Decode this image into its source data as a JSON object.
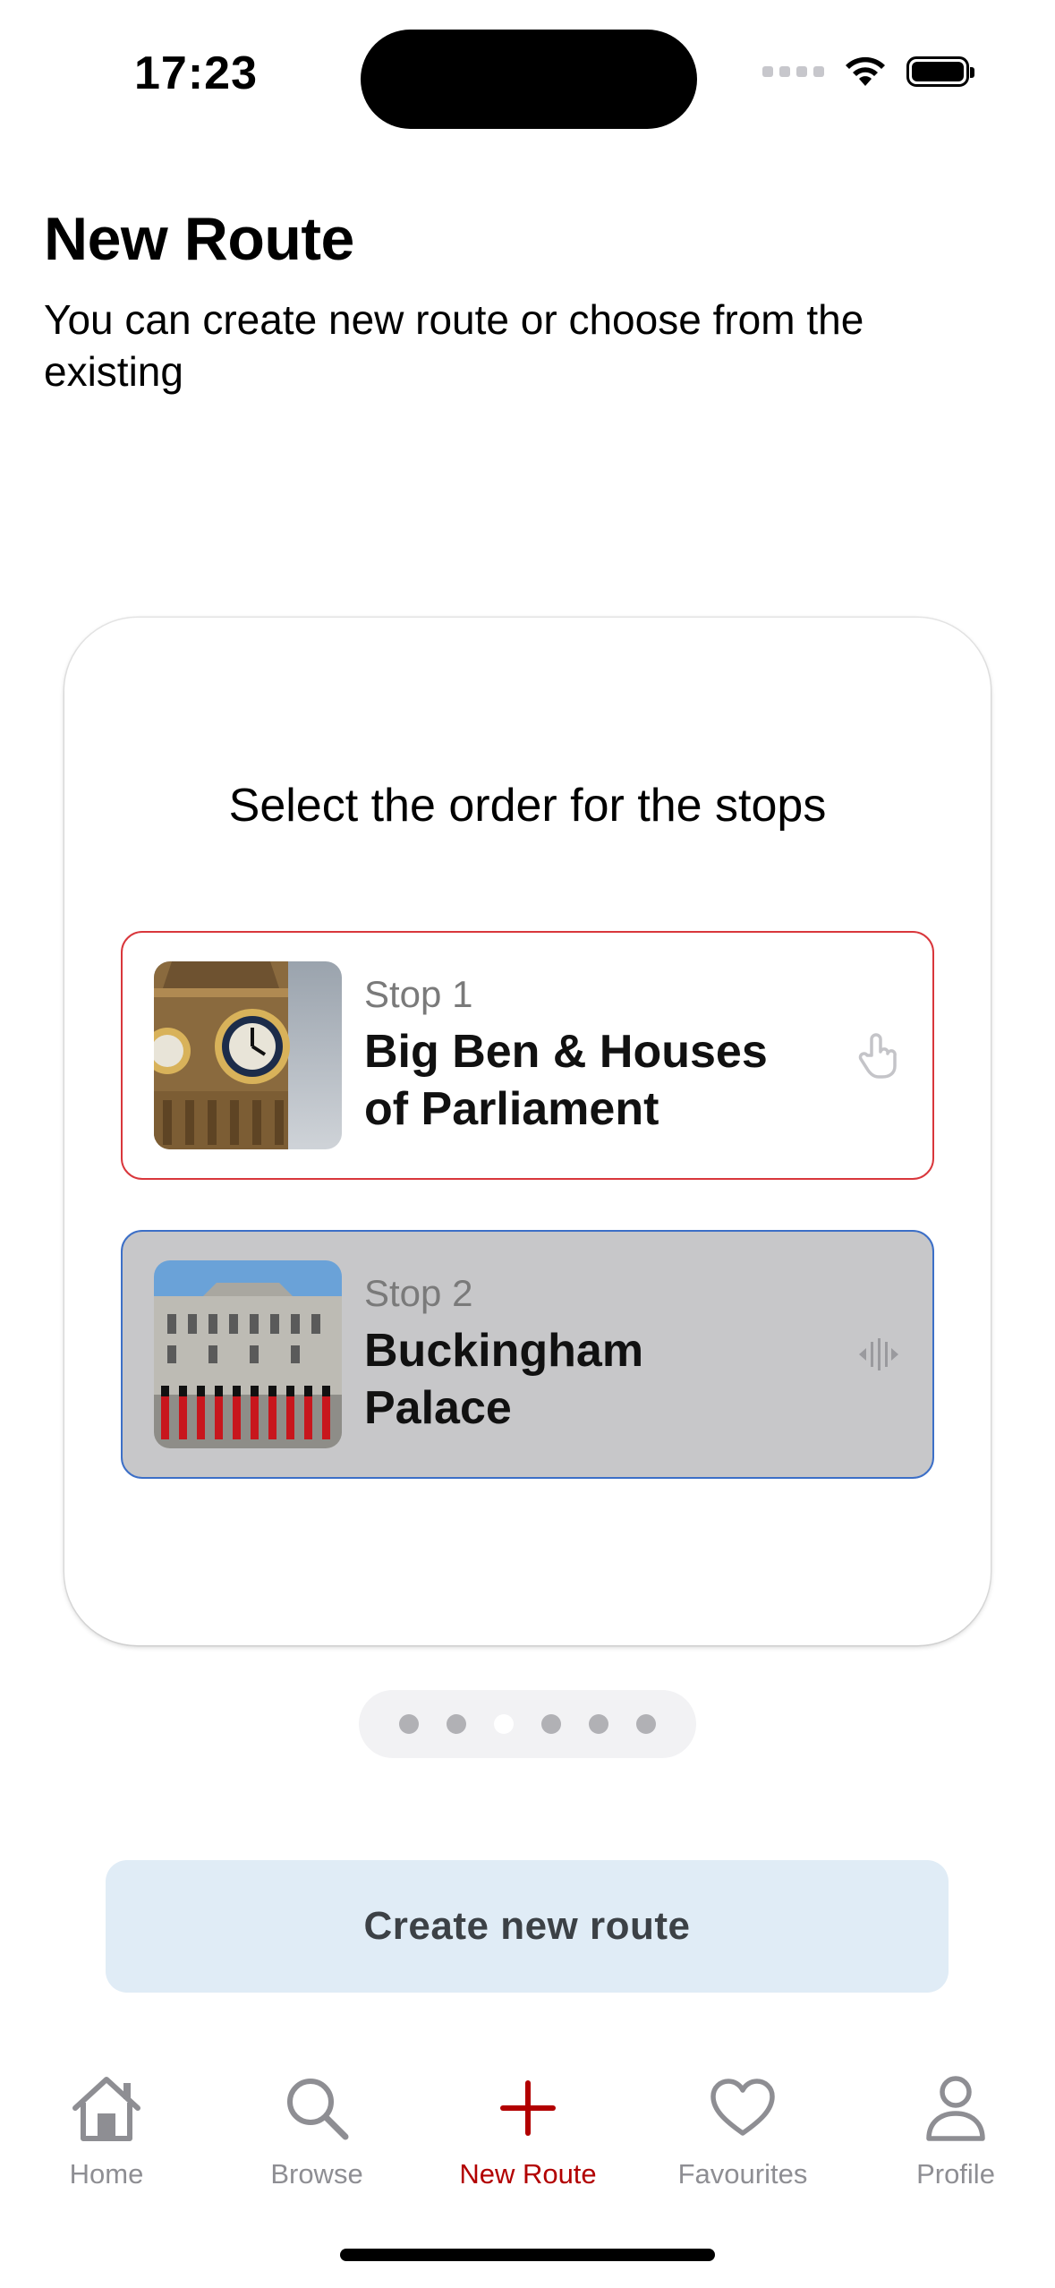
{
  "status_bar": {
    "time": "17:23"
  },
  "header": {
    "title": "New Route",
    "subtitle": "You can create new route or choose from the existing"
  },
  "card": {
    "heading": "Select the order for the stops",
    "stops": [
      {
        "label": "Stop 1",
        "name": "Big Ben & Houses of Parliament",
        "action_icon": "tap-hand-icon",
        "border_color": "#d9373c"
      },
      {
        "label": "Stop 2",
        "name": "Buckingham Palace",
        "action_icon": "drag-handle-icon",
        "border_color": "#3c6fc7"
      }
    ]
  },
  "pagination": {
    "total": 6,
    "active_index": 2
  },
  "create_button": {
    "label": "Create new route"
  },
  "tabbar": {
    "items": [
      {
        "label": "Home",
        "icon": "home-icon"
      },
      {
        "label": "Browse",
        "icon": "search-icon"
      },
      {
        "label": "New Route",
        "icon": "plus-icon",
        "active": true
      },
      {
        "label": "Favourites",
        "icon": "heart-icon"
      },
      {
        "label": "Profile",
        "icon": "profile-icon"
      }
    ],
    "active_color": "#b20000",
    "inactive_color": "#8e8e93"
  }
}
